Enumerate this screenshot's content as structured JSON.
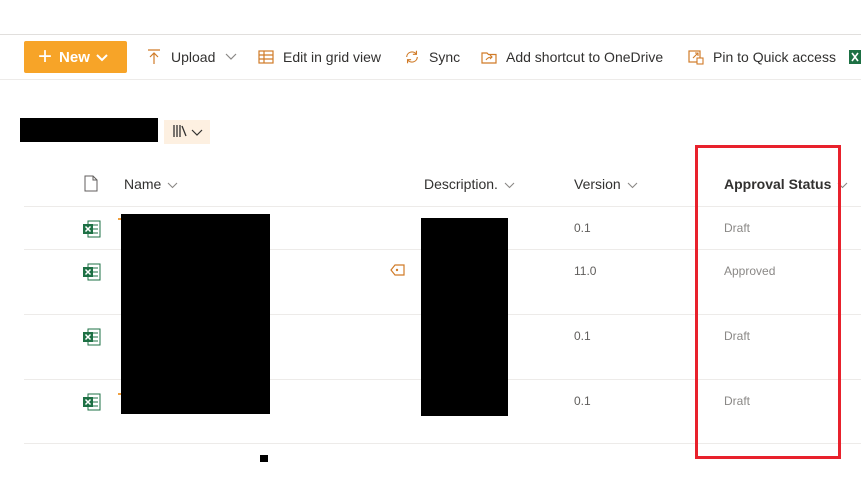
{
  "commandbar": {
    "new_label": "New",
    "upload_label": "Upload",
    "edit_grid_label": "Edit in grid view",
    "sync_label": "Sync",
    "shortcut_label": "Add shortcut to OneDrive",
    "pin_label": "Pin to Quick access"
  },
  "columns": {
    "name": "Name",
    "description": "Description.",
    "version": "Version",
    "approval": "Approval Status"
  },
  "rows": [
    {
      "version": "0.1",
      "status": "Draft"
    },
    {
      "version": "11.0",
      "status": "Approved"
    },
    {
      "version": "0.1",
      "status": "Draft"
    },
    {
      "version": "0.1",
      "status": "Draft"
    }
  ],
  "colors": {
    "accent": "#f7a428",
    "highlight": "#e8212c",
    "excel": "#1d7044"
  }
}
